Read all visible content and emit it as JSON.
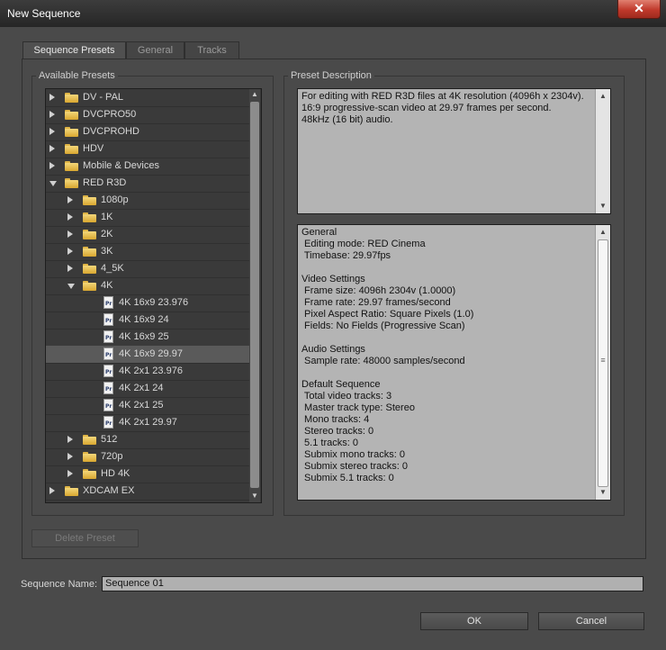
{
  "window": {
    "title": "New Sequence",
    "close_symbol": "✕"
  },
  "tabs": [
    {
      "label": "Sequence Presets",
      "active": true
    },
    {
      "label": "General",
      "active": false
    },
    {
      "label": "Tracks",
      "active": false
    }
  ],
  "presets": {
    "group_label": "Available Presets",
    "rows": [
      {
        "label": "DV - PAL",
        "type": "folder",
        "level": 0,
        "expanded": false
      },
      {
        "label": "DVCPRO50",
        "type": "folder",
        "level": 0,
        "expanded": false
      },
      {
        "label": "DVCPROHD",
        "type": "folder",
        "level": 0,
        "expanded": false
      },
      {
        "label": "HDV",
        "type": "folder",
        "level": 0,
        "expanded": false
      },
      {
        "label": "Mobile & Devices",
        "type": "folder",
        "level": 0,
        "expanded": false
      },
      {
        "label": "RED R3D",
        "type": "folder",
        "level": 0,
        "expanded": true
      },
      {
        "label": "1080p",
        "type": "folder",
        "level": 1,
        "expanded": false
      },
      {
        "label": "1K",
        "type": "folder",
        "level": 1,
        "expanded": false
      },
      {
        "label": "2K",
        "type": "folder",
        "level": 1,
        "expanded": false
      },
      {
        "label": "3K",
        "type": "folder",
        "level": 1,
        "expanded": false
      },
      {
        "label": "4_5K",
        "type": "folder",
        "level": 1,
        "expanded": false
      },
      {
        "label": "4K",
        "type": "folder",
        "level": 1,
        "expanded": true
      },
      {
        "label": "4K 16x9 23.976",
        "type": "preset",
        "level": 2
      },
      {
        "label": "4K 16x9 24",
        "type": "preset",
        "level": 2
      },
      {
        "label": "4K 16x9 25",
        "type": "preset",
        "level": 2
      },
      {
        "label": "4K 16x9 29.97",
        "type": "preset",
        "level": 2,
        "selected": true
      },
      {
        "label": "4K 2x1 23.976",
        "type": "preset",
        "level": 2
      },
      {
        "label": "4K 2x1 24",
        "type": "preset",
        "level": 2
      },
      {
        "label": "4K 2x1 25",
        "type": "preset",
        "level": 2
      },
      {
        "label": "4K 2x1 29.97",
        "type": "preset",
        "level": 2
      },
      {
        "label": "512",
        "type": "folder",
        "level": 1,
        "expanded": false
      },
      {
        "label": "720p",
        "type": "folder",
        "level": 1,
        "expanded": false
      },
      {
        "label": "HD 4K",
        "type": "folder",
        "level": 1,
        "expanded": false
      },
      {
        "label": "XDCAM EX",
        "type": "folder",
        "level": 0,
        "expanded": false
      }
    ],
    "preset_icon_text": "Pr",
    "delete_button": "Delete Preset",
    "scroll_up": "▲",
    "scroll_down": "▼"
  },
  "description": {
    "group_label": "Preset Description",
    "lines": [
      "For editing with RED R3D files at 4K resolution (4096h x 2304v).",
      "16:9 progressive-scan video at 29.97 frames per second.",
      "48kHz (16 bit) audio."
    ]
  },
  "details": {
    "lines": [
      "General",
      " Editing mode: RED Cinema",
      " Timebase: 29.97fps",
      "",
      "Video Settings",
      " Frame size: 4096h 2304v (1.0000)",
      " Frame rate: 29.97 frames/second",
      " Pixel Aspect Ratio: Square Pixels (1.0)",
      " Fields: No Fields (Progressive Scan)",
      "",
      "Audio Settings",
      " Sample rate: 48000 samples/second",
      "",
      "Default Sequence",
      " Total video tracks: 3",
      " Master track type: Stereo",
      " Mono tracks: 4",
      " Stereo tracks: 0",
      " 5.1 tracks: 0",
      " Submix mono tracks: 0",
      " Submix stereo tracks: 0",
      " Submix 5.1 tracks: 0"
    ],
    "thumb_grip": "≡"
  },
  "sequence_name": {
    "label": "Sequence Name:",
    "value": "Sequence 01"
  },
  "buttons": {
    "ok": "OK",
    "cancel": "Cancel"
  }
}
